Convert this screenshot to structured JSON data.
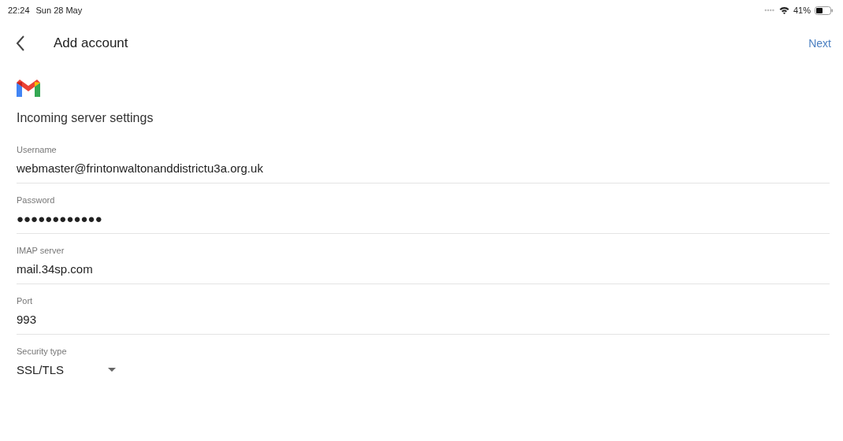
{
  "status_bar": {
    "time": "22:24",
    "date": "Sun 28 May",
    "battery": "41%"
  },
  "header": {
    "title": "Add account",
    "action": "Next"
  },
  "heading": "Incoming server settings",
  "fields": [
    {
      "kind": "text",
      "label": "Username",
      "value": "webmaster@frintonwaltonanddistrictu3a.org.uk"
    },
    {
      "kind": "text",
      "label": "Password",
      "value": "●●●●●●●●●●●●"
    },
    {
      "kind": "text",
      "label": "IMAP server",
      "value": "mail.34sp.com"
    },
    {
      "kind": "text",
      "label": "Port",
      "value": "993"
    },
    {
      "kind": "dropdown",
      "label": "Security type",
      "value": "SSL/TLS"
    }
  ]
}
